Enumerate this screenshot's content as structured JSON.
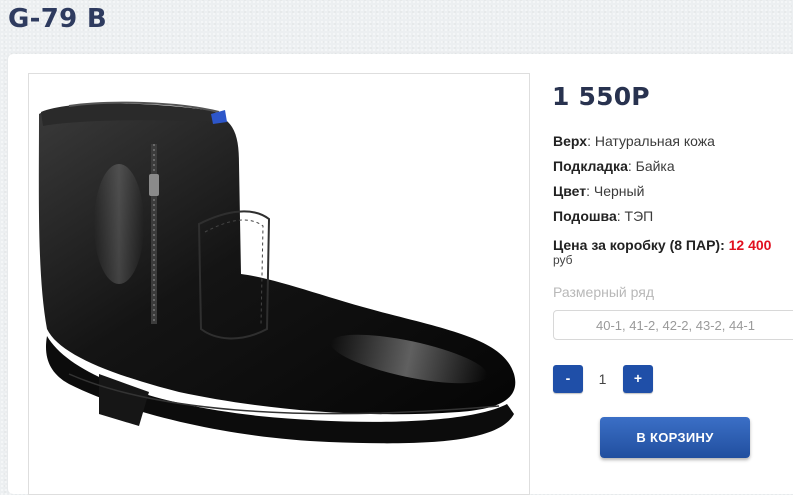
{
  "product": {
    "title": "G-79 B",
    "price": "1 550Р",
    "photo_label": "product-photo-black-leather-boot"
  },
  "attributes": [
    {
      "key": "Верх",
      "value": ": Натуральная кожа"
    },
    {
      "key": "Подкладка",
      "value": ": Байка"
    },
    {
      "key": "Цвет",
      "value": ": Черный"
    },
    {
      "key": "Подошва",
      "value": ": ТЭП"
    }
  ],
  "box_price": {
    "label": "Цена за коробку (8 ПАР): ",
    "value": "12 400",
    "currency": "руб"
  },
  "size_range": {
    "label": "Размерный ряд",
    "selected": "40-1, 41-2, 42-2, 43-2, 44-1"
  },
  "quantity": {
    "minus_label": "-",
    "value": "1",
    "plus_label": "+"
  },
  "cart": {
    "button_label": "В КОРЗИНУ"
  },
  "colors": {
    "title": "#2e3b5f",
    "accent_button": "#1f4fa8",
    "price_highlight": "#e10f1f"
  }
}
